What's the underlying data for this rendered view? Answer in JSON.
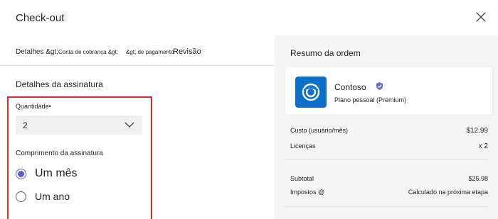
{
  "dialog": {
    "title": "Check-out"
  },
  "steps": [
    {
      "label": "Detalhes &gt;"
    },
    {
      "label": "Conta de cobrança &gt;"
    },
    {
      "label": "&gt; de pagamento"
    },
    {
      "label": "Revisão"
    }
  ],
  "subscription": {
    "section_title": "Detalhes da assinatura",
    "quantity_label": "Quantidade•",
    "quantity_value": "2",
    "length_label": "Comprimento da assinatura",
    "options": [
      {
        "label": "Um mês",
        "selected": true
      },
      {
        "label": "Um ano",
        "selected": false
      }
    ]
  },
  "summary": {
    "title": "Resumo da ordem",
    "product_name": "Contoso",
    "plan": "Plano pessoal (Premium)",
    "cost_label": "Custo (usuário/mês)",
    "cost_value": "$12.99",
    "licenses_label": "Licenças",
    "licenses_value": "x 2",
    "subtotal_label": "Subtotal",
    "subtotal_value": "$25.98",
    "taxes_label": "Impostos @",
    "taxes_value": "Calculado na próxima etapa"
  },
  "colors": {
    "accent": "#5b5fc7",
    "highlight_border": "#e4242b",
    "logo_bg": "#0b6fcb",
    "summary_bg": "#f5f5f5"
  },
  "icons": {
    "close": "close-icon",
    "chevron": "chevron-down-icon",
    "verified": "verified-badge-icon",
    "logo": "contoso-logo-icon"
  }
}
